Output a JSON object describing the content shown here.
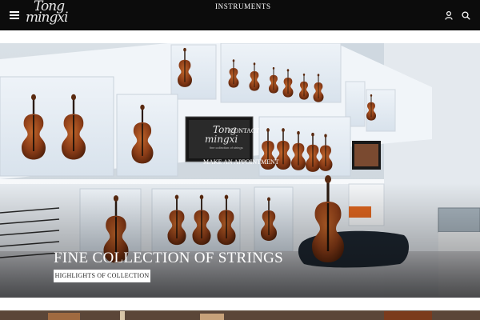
{
  "header": {
    "logo_line1": "Tong",
    "logo_line2": "mingxi",
    "nav_label": "INSTRUMENTS",
    "menu_icon": "hamburger-icon",
    "account_icon": "user-icon",
    "search_icon": "search-icon"
  },
  "hero": {
    "title": "FINE COLLECTION OF STRINGS",
    "button_label": "HIGHLIGHTS OF COLLECTION",
    "screen_logo_line1": "Tong",
    "screen_logo_line2": "mingxi",
    "screen_logo_tagline": "fine collection of strings",
    "contact_label": "CONTACT",
    "appointment_label": "MAKE AN APPOINTMENT"
  },
  "colors": {
    "topbar": "#0c0c0c",
    "background": "#ffffff",
    "violin_wood": "#8a3c17",
    "shelf_light": "#f4f7fa"
  }
}
